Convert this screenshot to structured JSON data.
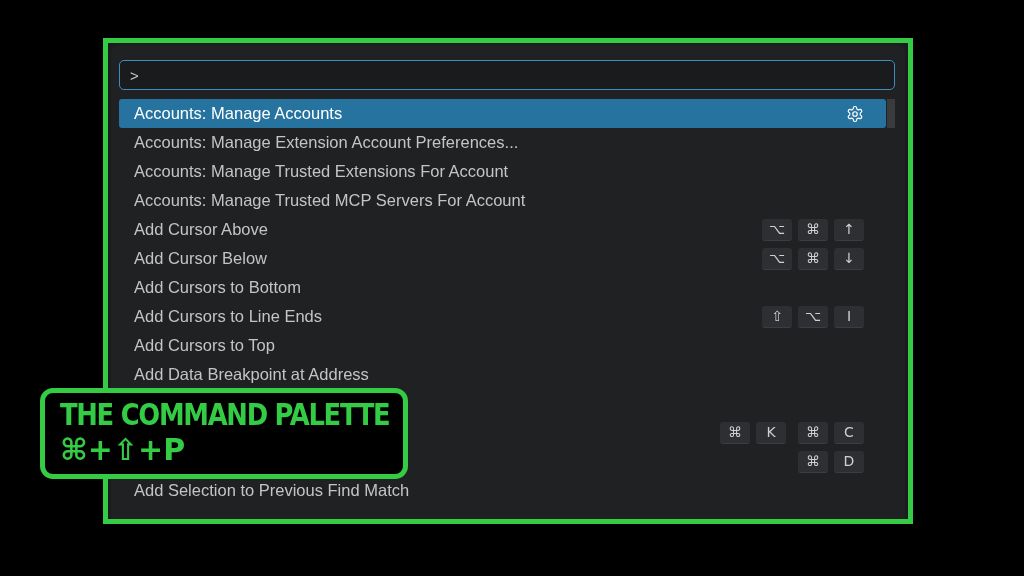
{
  "search": {
    "value": ">"
  },
  "commands": [
    {
      "label": "Accounts: Manage Accounts",
      "selected": true,
      "gear": true
    },
    {
      "label": "Accounts: Manage Extension Account Preferences...",
      "selected": false
    },
    {
      "label": "Accounts: Manage Trusted Extensions For Account",
      "selected": false
    },
    {
      "label": "Accounts: Manage Trusted MCP Servers For Account",
      "selected": false
    },
    {
      "label": "Add Cursor Above",
      "selected": false,
      "chords": [
        [
          "⌥",
          "⌘",
          "↑"
        ]
      ]
    },
    {
      "label": "Add Cursor Below",
      "selected": false,
      "chords": [
        [
          "⌥",
          "⌘",
          "↓"
        ]
      ]
    },
    {
      "label": "Add Cursors to Bottom",
      "selected": false
    },
    {
      "label": "Add Cursors to Line Ends",
      "selected": false,
      "chords": [
        [
          "⇧",
          "⌥",
          "I"
        ]
      ]
    },
    {
      "label": "Add Cursors to Top",
      "selected": false
    },
    {
      "label": "Add Data Breakpoint at Address",
      "selected": false
    },
    {
      "selected": false
    },
    {
      "selected": false,
      "chords": [
        [
          "⌘",
          "K"
        ],
        [
          "⌘",
          "C"
        ]
      ]
    },
    {
      "selected": false,
      "chords": [
        [
          "⌘",
          "D"
        ]
      ]
    },
    {
      "label": "Add Selection to Previous Find Match",
      "selected": false
    }
  ],
  "overlay": {
    "title": "THE COMMAND PALETTE",
    "shortcut": "⌘+⇧+P"
  }
}
